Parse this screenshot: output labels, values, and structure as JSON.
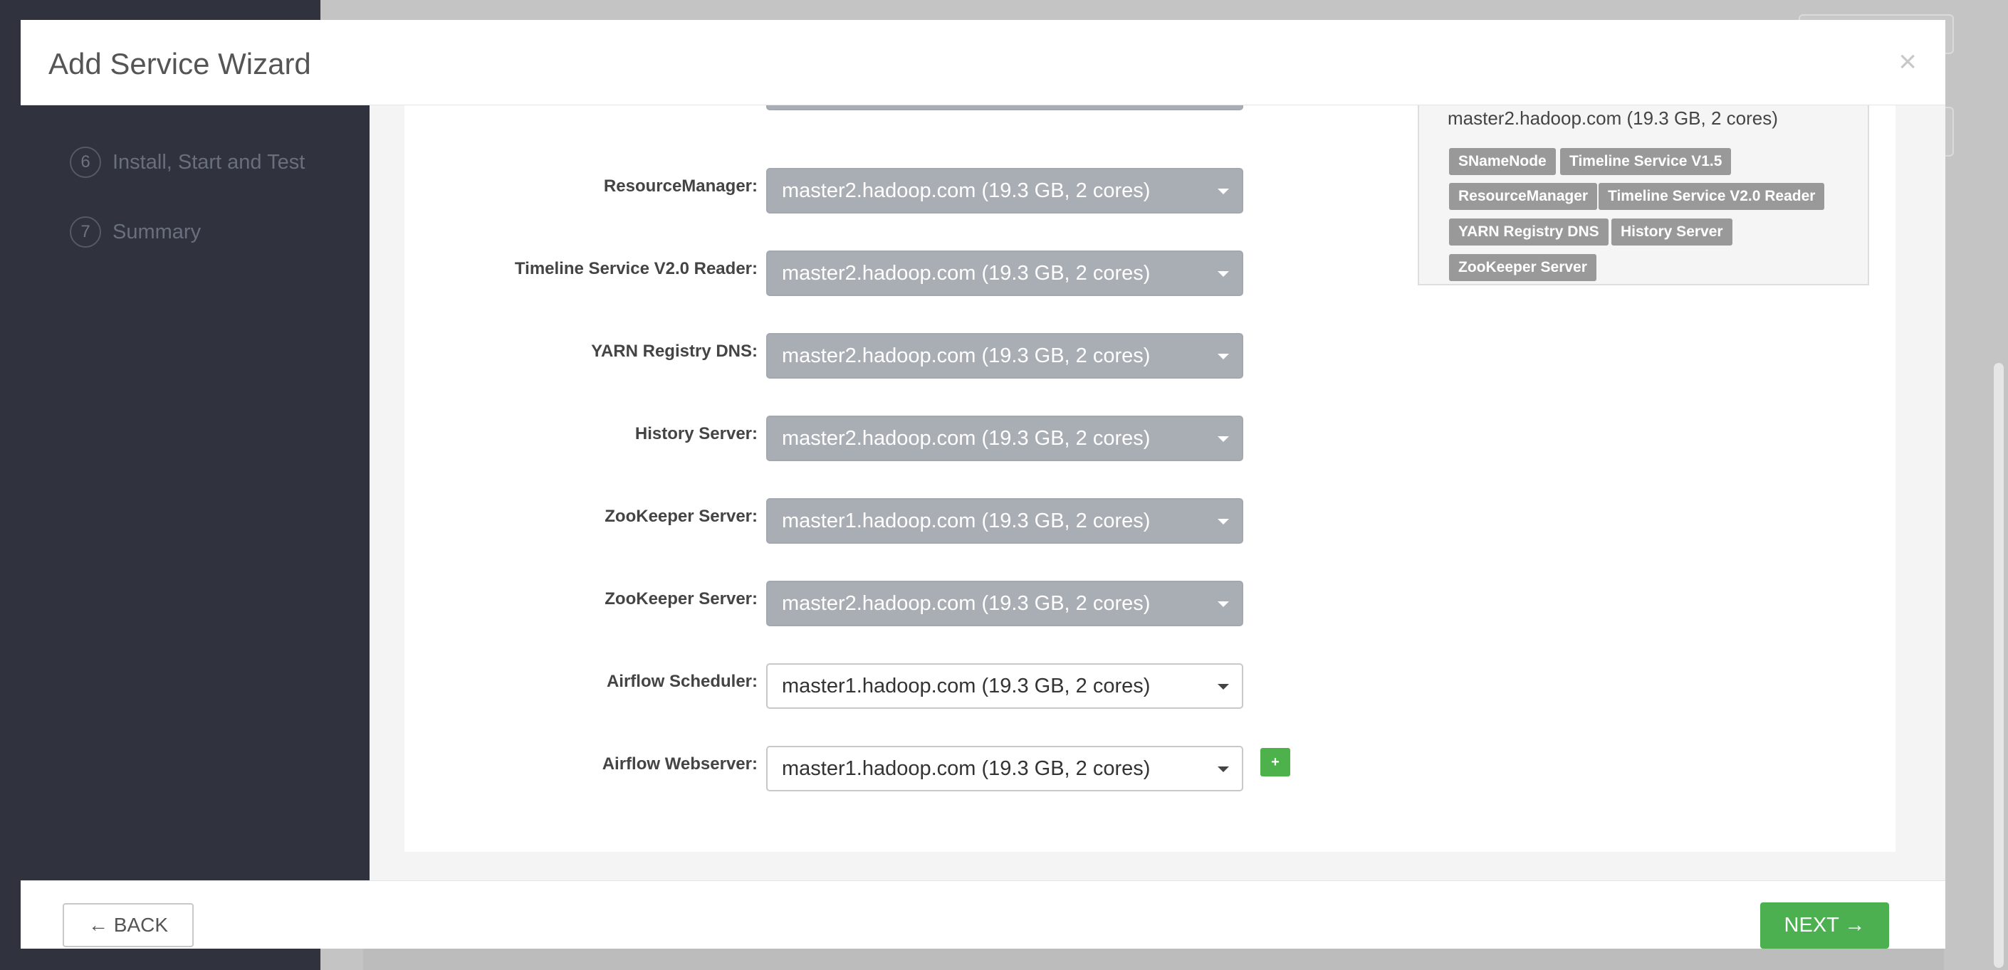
{
  "modal": {
    "title": "Add Service Wizard",
    "close_glyph": "×"
  },
  "sidebar": {
    "steps": [
      {
        "num": "6",
        "label": "Install, Start and Test"
      },
      {
        "num": "7",
        "label": "Summary"
      }
    ]
  },
  "assignments": [
    {
      "label": "ResourceManager:",
      "value": "master2.hadoop.com (19.3 GB, 2 cores)",
      "enabled": false
    },
    {
      "label": "Timeline Service V2.0 Reader:",
      "value": "master2.hadoop.com (19.3 GB, 2 cores)",
      "enabled": false
    },
    {
      "label": "YARN Registry DNS:",
      "value": "master2.hadoop.com (19.3 GB, 2 cores)",
      "enabled": false
    },
    {
      "label": "History Server:",
      "value": "master2.hadoop.com (19.3 GB, 2 cores)",
      "enabled": false
    },
    {
      "label": "ZooKeeper Server:",
      "value": "master1.hadoop.com (19.3 GB, 2 cores)",
      "enabled": false
    },
    {
      "label": "ZooKeeper Server:",
      "value": "master2.hadoop.com (19.3 GB, 2 cores)",
      "enabled": false
    },
    {
      "label": "Airflow Scheduler:",
      "value": "master1.hadoop.com (19.3 GB, 2 cores)",
      "enabled": true
    },
    {
      "label": "Airflow Webserver:",
      "value": "master1.hadoop.com (19.3 GB, 2 cores)",
      "enabled": true
    }
  ],
  "add_button": "+",
  "host_summary": {
    "host": "master2.hadoop.com (19.3 GB, 2 cores)",
    "components": [
      "SNameNode",
      "Timeline Service V1.5",
      "ResourceManager",
      "Timeline Service V2.0 Reader",
      "YARN Registry DNS",
      "History Server",
      "ZooKeeper Server"
    ]
  },
  "footer": {
    "back_label": "← BACK",
    "next_label": "NEXT →"
  },
  "colors": {
    "sidebar": "#30323d",
    "next_button": "#4caf50",
    "disabled_select": "#a9adb4"
  }
}
